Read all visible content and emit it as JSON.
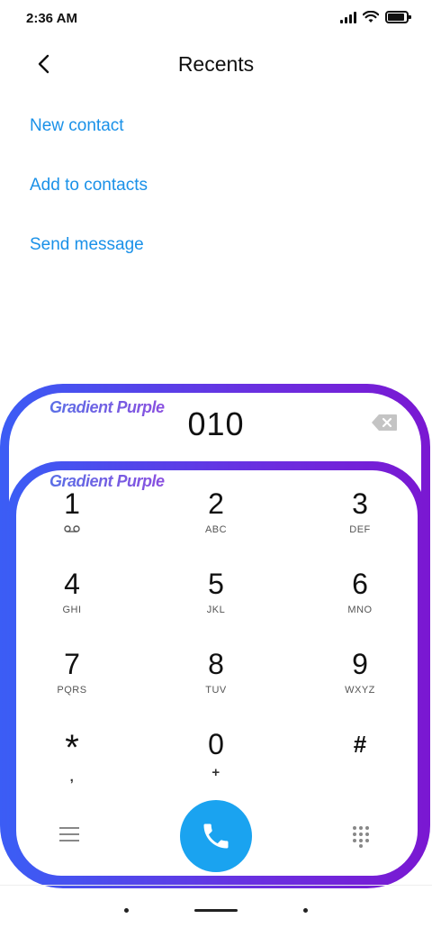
{
  "status_bar": {
    "time": "2:36 AM"
  },
  "header": {
    "title": "Recents",
    "back_icon": "chevron-left-icon"
  },
  "actions": {
    "new_contact": "New contact",
    "add_to_contacts": "Add to contacts",
    "send_message": "Send message"
  },
  "watermark": "Gradient Purple",
  "dialer": {
    "number": "010",
    "keys": [
      {
        "digit": "1",
        "letters": ""
      },
      {
        "digit": "2",
        "letters": "ABC"
      },
      {
        "digit": "3",
        "letters": "DEF"
      },
      {
        "digit": "4",
        "letters": "GHI"
      },
      {
        "digit": "5",
        "letters": "JKL"
      },
      {
        "digit": "6",
        "letters": "MNO"
      },
      {
        "digit": "7",
        "letters": "PQRS"
      },
      {
        "digit": "8",
        "letters": "TUV"
      },
      {
        "digit": "9",
        "letters": "WXYZ"
      },
      {
        "digit": "*",
        "letters": ","
      },
      {
        "digit": "0",
        "letters": "+"
      },
      {
        "digit": "#",
        "letters": ""
      }
    ]
  },
  "colors": {
    "link": "#1a91e8",
    "call_button": "#1aa3f0",
    "frame_gradient_start": "#3b5df5",
    "frame_gradient_end": "#7a18d2"
  }
}
